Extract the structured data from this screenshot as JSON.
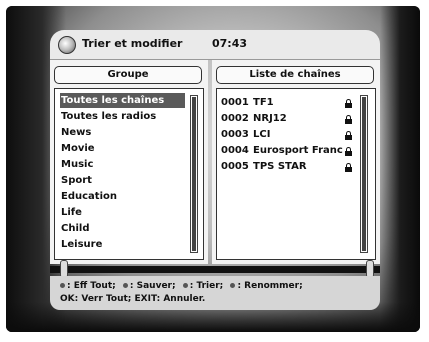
{
  "window": {
    "title": "Trier et modifier",
    "time": "07:43"
  },
  "group_panel": {
    "header": "Groupe",
    "items": [
      {
        "label": "Toutes les chaînes",
        "selected": true
      },
      {
        "label": "Toutes les radios"
      },
      {
        "label": "News"
      },
      {
        "label": "Movie"
      },
      {
        "label": "Music"
      },
      {
        "label": "Sport"
      },
      {
        "label": "Education"
      },
      {
        "label": "Life"
      },
      {
        "label": "Child"
      },
      {
        "label": "Leisure"
      }
    ]
  },
  "channel_panel": {
    "header": "Liste de chaînes",
    "channels": [
      {
        "number": "0001",
        "name": "TF1",
        "locked": true
      },
      {
        "number": "0002",
        "name": "NRJ12",
        "locked": true
      },
      {
        "number": "0003",
        "name": "LCI",
        "locked": true
      },
      {
        "number": "0004",
        "name": "Eurosport Franc",
        "locked": true
      },
      {
        "number": "0005",
        "name": "TPS STAR",
        "locked": true
      }
    ]
  },
  "help": {
    "line1": {
      "eff_tout": ": Eff Tout;",
      "sauver": ": Sauver;",
      "trier": ": Trier;",
      "renommer": ": Renommer;"
    },
    "line2": "OK: Verr Tout; EXIT: Annuler."
  },
  "icons": {
    "title": "settings-disc-icon",
    "lock": "lock-icon",
    "help_bullet": "color-key-dot-icon"
  }
}
